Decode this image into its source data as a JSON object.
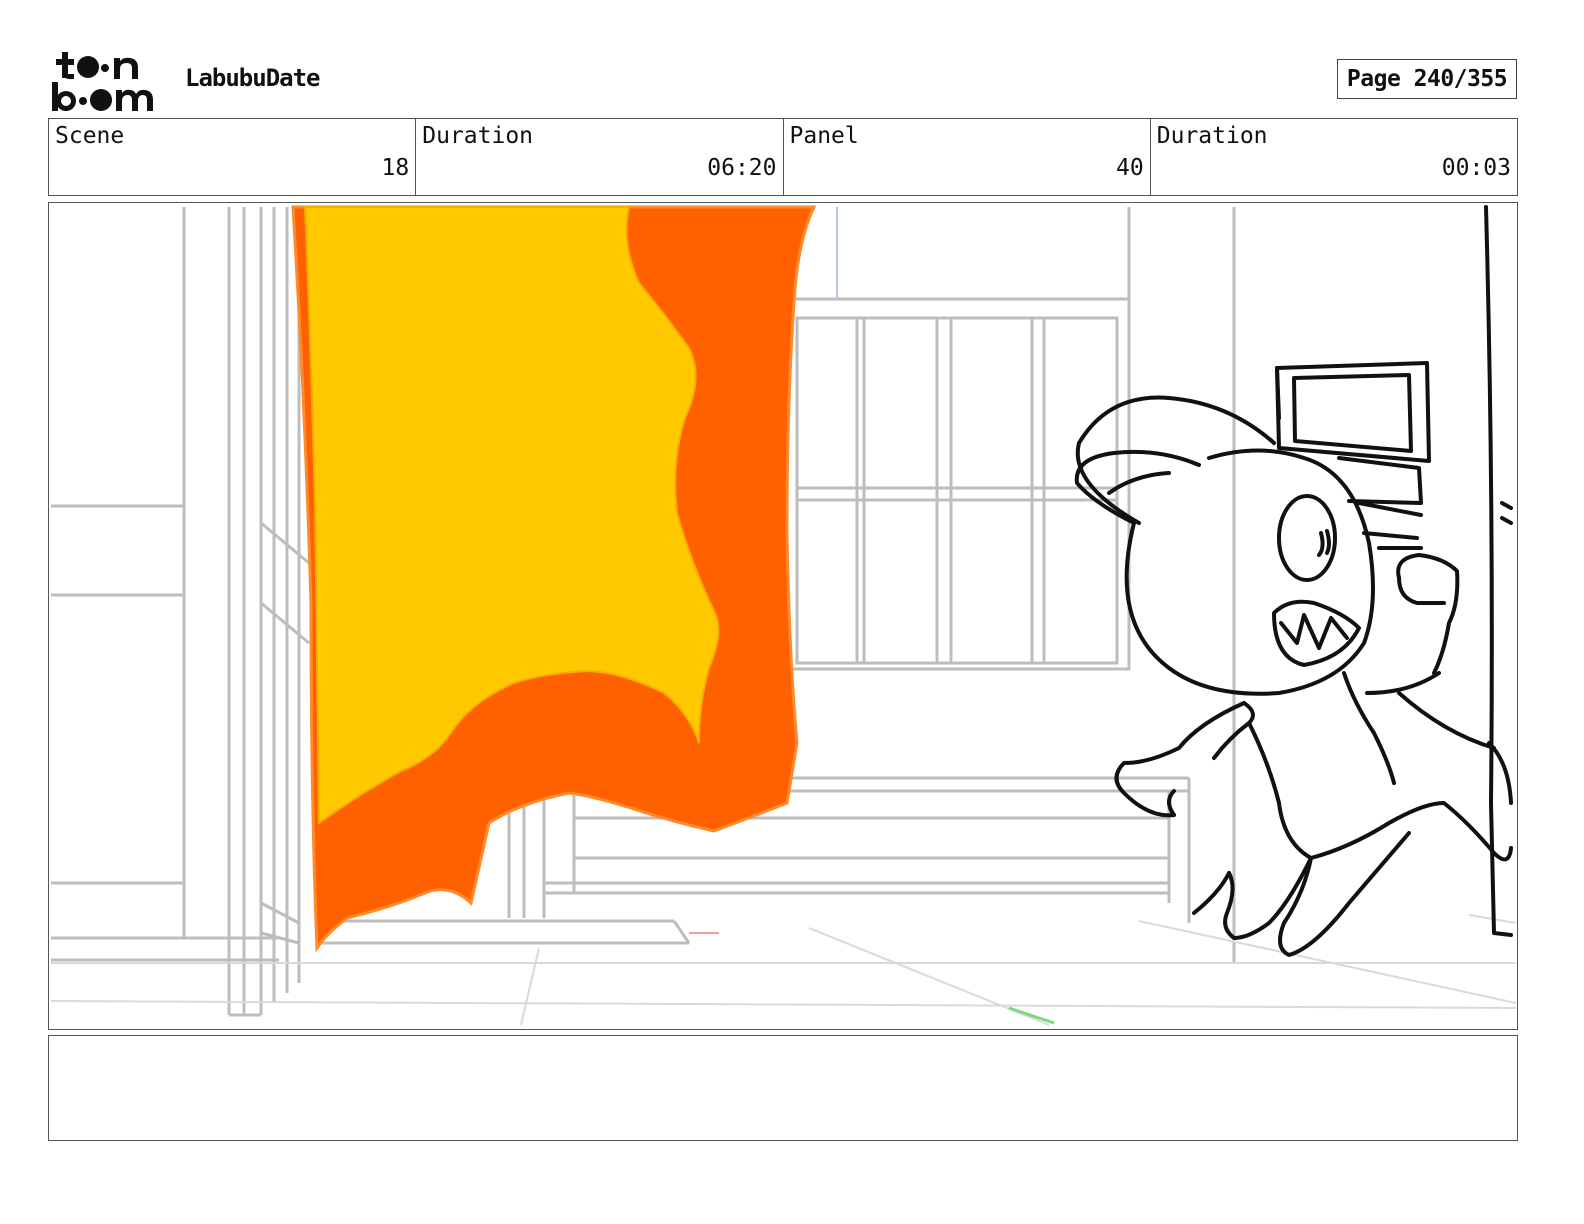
{
  "header": {
    "logo_text": "toon boom",
    "project_title": "LabubuDate",
    "page_indicator": "Page 240/355"
  },
  "info": {
    "scene_label": "Scene",
    "scene_value": "18",
    "scene_duration_label": "Duration",
    "scene_duration_value": "06:20",
    "panel_label": "Panel",
    "panel_value": "40",
    "panel_duration_label": "Duration",
    "panel_duration_value": "00:03"
  },
  "panel_image": {
    "colors": {
      "banner_outer": "#ff6000",
      "banner_inner": "#ffc800",
      "sketch_gray": "#bdbdbd",
      "ink": "#111111"
    }
  },
  "notes": {
    "text": ""
  }
}
